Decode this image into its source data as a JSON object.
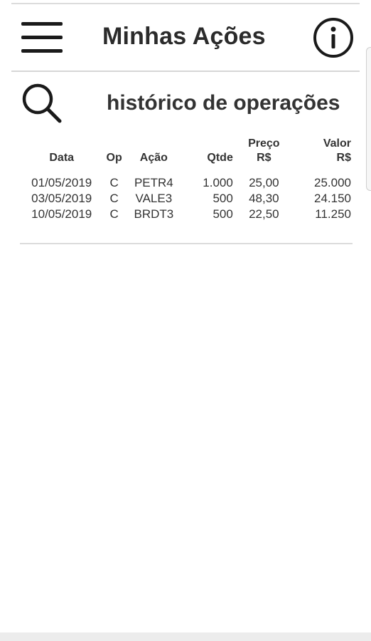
{
  "header": {
    "title": "Minhas Ações",
    "menu_icon": "hamburger-menu-icon",
    "info_icon": "info-icon"
  },
  "section": {
    "search_icon": "search-icon",
    "title": "histórico de operações"
  },
  "table": {
    "columns": {
      "data": "Data",
      "op": "Op",
      "acao": "Ação",
      "qtde": "Qtde",
      "preco_line1": "Preço",
      "preco_line2": "R$",
      "valor_line1": "Valor",
      "valor_line2": "R$"
    },
    "rows": [
      {
        "data": "01/05/2019",
        "op": "C",
        "acao": "PETR4",
        "qtde": "1.000",
        "preco": "25,00",
        "valor": "25.000"
      },
      {
        "data": "03/05/2019",
        "op": "C",
        "acao": "VALE3",
        "qtde": "500",
        "preco": "48,30",
        "valor": "24.150"
      },
      {
        "data": "10/05/2019",
        "op": "C",
        "acao": "BRDT3",
        "qtde": "500",
        "preco": "22,50",
        "valor": "11.250"
      }
    ]
  },
  "colors": {
    "text": "#2b2b2b",
    "divider": "#d6d6d6",
    "background": "#ffffff"
  }
}
